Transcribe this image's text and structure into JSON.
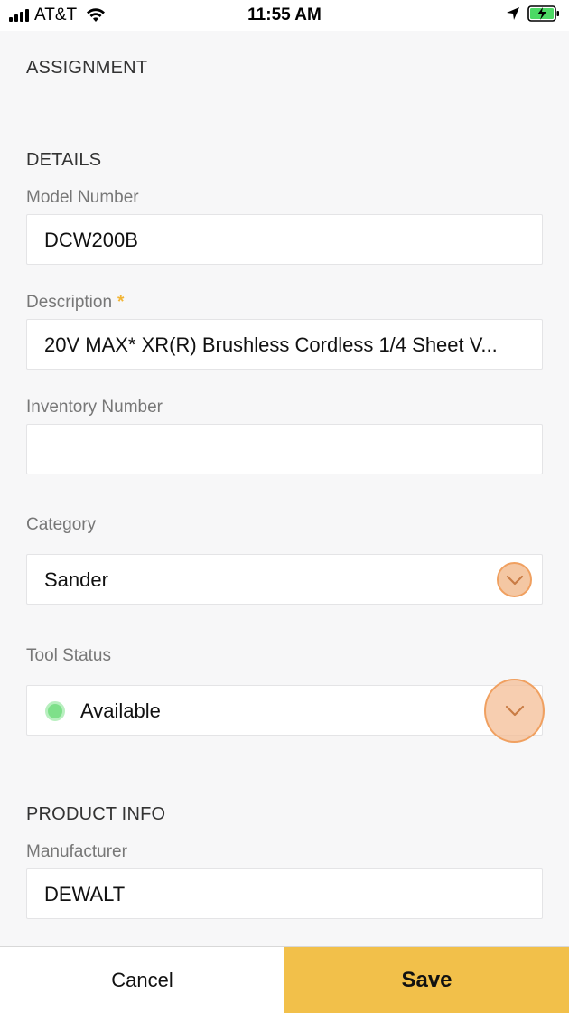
{
  "status_bar": {
    "carrier": "AT&T",
    "time": "11:55 AM",
    "icons": [
      "signal-icon",
      "wifi-icon",
      "location-icon",
      "battery-charging-icon"
    ]
  },
  "sections": {
    "assignment": "ASSIGNMENT",
    "details": "DETAILS",
    "product_info": "PRODUCT INFO"
  },
  "fields": {
    "model_number": {
      "label": "Model Number",
      "value": "DCW200B"
    },
    "description": {
      "label": "Description",
      "required_mark": "*",
      "value": "20V MAX* XR(R) Brushless Cordless 1/4 Sheet V..."
    },
    "inventory_number": {
      "label": "Inventory Number",
      "value": ""
    },
    "category": {
      "label": "Category",
      "value": "Sander"
    },
    "tool_status": {
      "label": "Tool Status",
      "value": "Available",
      "status_color": "#7ee08a"
    },
    "manufacturer": {
      "label": "Manufacturer",
      "value": "DEWALT"
    }
  },
  "actions": {
    "cancel_label": "Cancel",
    "save_label": "Save"
  },
  "colors": {
    "accent": "#f2c04a",
    "required": "#f2b536",
    "dropdown_highlight": "#f0a060"
  }
}
